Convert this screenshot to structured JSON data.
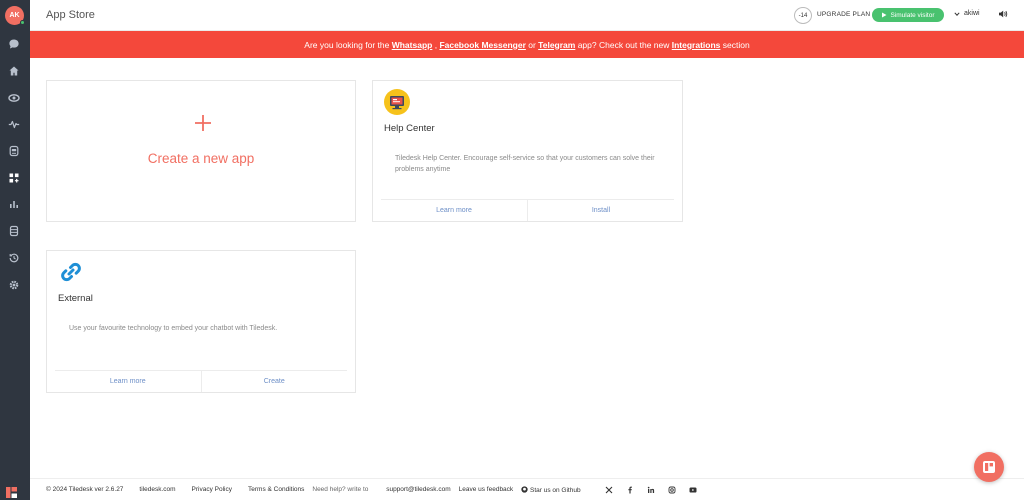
{
  "colors": {
    "sidebar": "#2f3640",
    "accent": "#f16f62",
    "banner": "#f4483b",
    "success": "#49c26f",
    "link": "#6d8fc7"
  },
  "user": {
    "initials": "AK"
  },
  "sidebar": {
    "items": [
      {
        "icon": "chat-icon"
      },
      {
        "icon": "home-icon"
      },
      {
        "icon": "eye-icon"
      },
      {
        "icon": "activity-icon"
      },
      {
        "icon": "robot-icon"
      },
      {
        "icon": "apps-icon"
      },
      {
        "icon": "analytics-icon"
      },
      {
        "icon": "database-icon"
      },
      {
        "icon": "history-icon"
      },
      {
        "icon": "settings-icon"
      }
    ]
  },
  "header": {
    "title": "App Store",
    "trial_days": "-14",
    "upgrade_label": "UPGRADE PLAN",
    "simulate_label": "Simulate visitor",
    "project_name": "akiwi"
  },
  "banner": {
    "text_1": "Are you looking for the ",
    "link_whatsapp": "Whatsapp",
    "sep_1": " , ",
    "link_messenger": "Facebook Messenger",
    "text_2": " or ",
    "link_telegram": "Telegram",
    "text_3": " app? Check out the new ",
    "link_integrations": "Integrations",
    "text_4": " section"
  },
  "create_card": {
    "label": "Create a new app"
  },
  "apps": [
    {
      "title": "Help Center",
      "description": "Tiledesk Help Center. Encourage self-service so that your customers can solve their problems anytime",
      "learn_more": "Learn more",
      "action": "Install"
    },
    {
      "title": "External",
      "description": "Use your favourite technology to embed your chatbot with Tiledesk.",
      "learn_more": "Learn more",
      "action": "Create"
    }
  ],
  "footer": {
    "copyright": "© 2024 Tiledesk ver 2.6.27",
    "site": "tiledesk.com",
    "privacy": "Privacy Policy",
    "terms": "Terms & Conditions",
    "help_prefix": "Need help? write to",
    "support_email": "support@tiledesk.com",
    "feedback": "Leave us feedback",
    "github": "Star us on Github"
  }
}
